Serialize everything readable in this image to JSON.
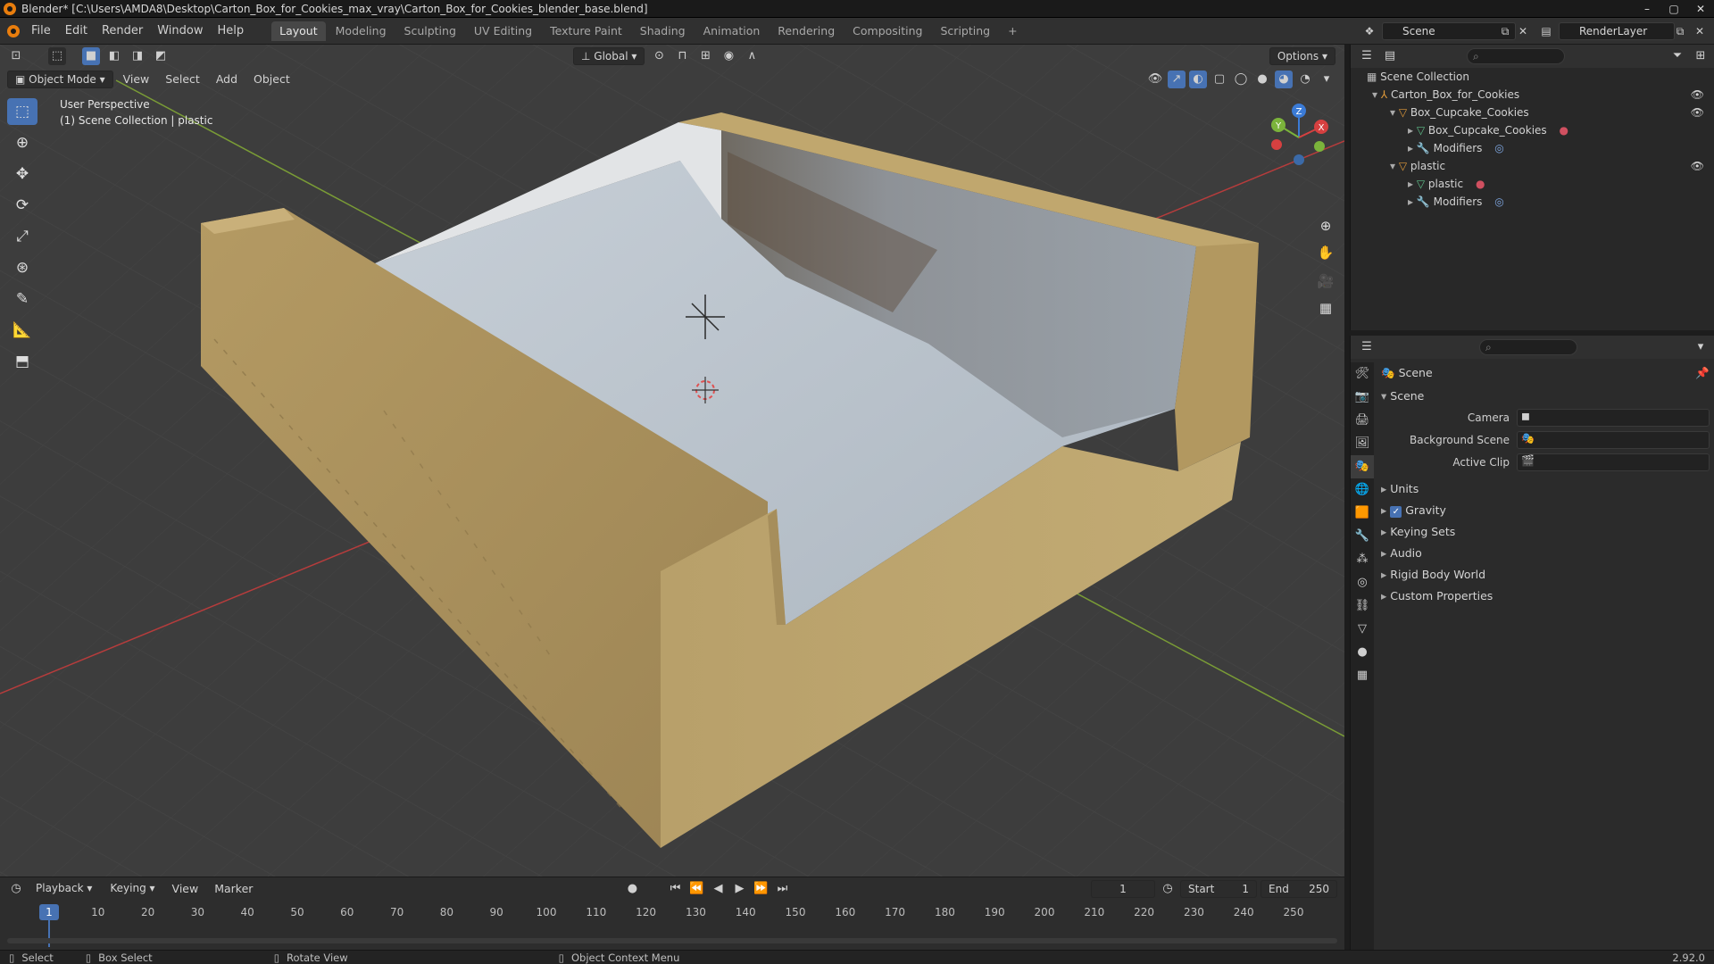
{
  "window": {
    "title": "Blender* [C:\\Users\\AMDA8\\Desktop\\Carton_Box_for_Cookies_max_vray\\Carton_Box_for_Cookies_blender_base.blend]",
    "minimize": "–",
    "maximize": "▢",
    "close": "✕"
  },
  "menus": [
    "File",
    "Edit",
    "Render",
    "Window",
    "Help"
  ],
  "workspaces": [
    "Layout",
    "Modeling",
    "Sculpting",
    "UV Editing",
    "Texture Paint",
    "Shading",
    "Animation",
    "Rendering",
    "Compositing",
    "Scripting"
  ],
  "add_workspace": "+",
  "scene_name": "Scene",
  "view_layer": "RenderLayer",
  "viewport": {
    "transform_orientation": "Global",
    "options": "Options",
    "mode": "Object Mode",
    "header_menus": [
      "View",
      "Select",
      "Add",
      "Object"
    ],
    "overlay_line1": "User Perspective",
    "overlay_line2": "(1) Scene Collection | plastic",
    "gizmo_x": "X",
    "gizmo_y": "Y",
    "gizmo_z": "Z"
  },
  "outliner": {
    "root": "Scene Collection",
    "items": [
      {
        "label": "Carton_Box_for_Cookies",
        "level": 1
      },
      {
        "label": "Box_Cupcake_Cookies",
        "level": 2
      },
      {
        "label": "Box_Cupcake_Cookies",
        "level": 3
      },
      {
        "label": "Modifiers",
        "level": 3
      },
      {
        "label": "plastic",
        "level": 2
      },
      {
        "label": "plastic",
        "level": 3
      },
      {
        "label": "Modifiers",
        "level": 3
      }
    ]
  },
  "properties": {
    "header": "Scene",
    "panel": "Scene",
    "fields": [
      {
        "label": "Camera"
      },
      {
        "label": "Background Scene"
      },
      {
        "label": "Active Clip"
      }
    ],
    "subpanels": [
      "Units",
      "Gravity",
      "Keying Sets",
      "Audio",
      "Rigid Body World",
      "Custom Properties"
    ],
    "gravity_checked": true
  },
  "timeline": {
    "menus": [
      "Playback",
      "Keying",
      "View",
      "Marker"
    ],
    "current_frame": "1",
    "start_label": "Start",
    "start": "1",
    "end_label": "End",
    "end": "250",
    "ticks": [
      "10",
      "20",
      "30",
      "40",
      "50",
      "60",
      "70",
      "80",
      "90",
      "100",
      "110",
      "120",
      "130",
      "140",
      "150",
      "160",
      "170",
      "180",
      "190",
      "200",
      "210",
      "220",
      "230",
      "240",
      "250"
    ],
    "playhead": "1"
  },
  "statusbar": {
    "select": "Select",
    "box_select": "Box Select",
    "rotate_view": "Rotate View",
    "context_menu": "Object Context Menu",
    "version": "2.92.0"
  },
  "colors": {
    "accent": "#4772b3",
    "cardboard": "#b39a62",
    "plastic": "#b8c2cc",
    "grid_x": "#c33a3a",
    "grid_y": "#7aa33a"
  }
}
